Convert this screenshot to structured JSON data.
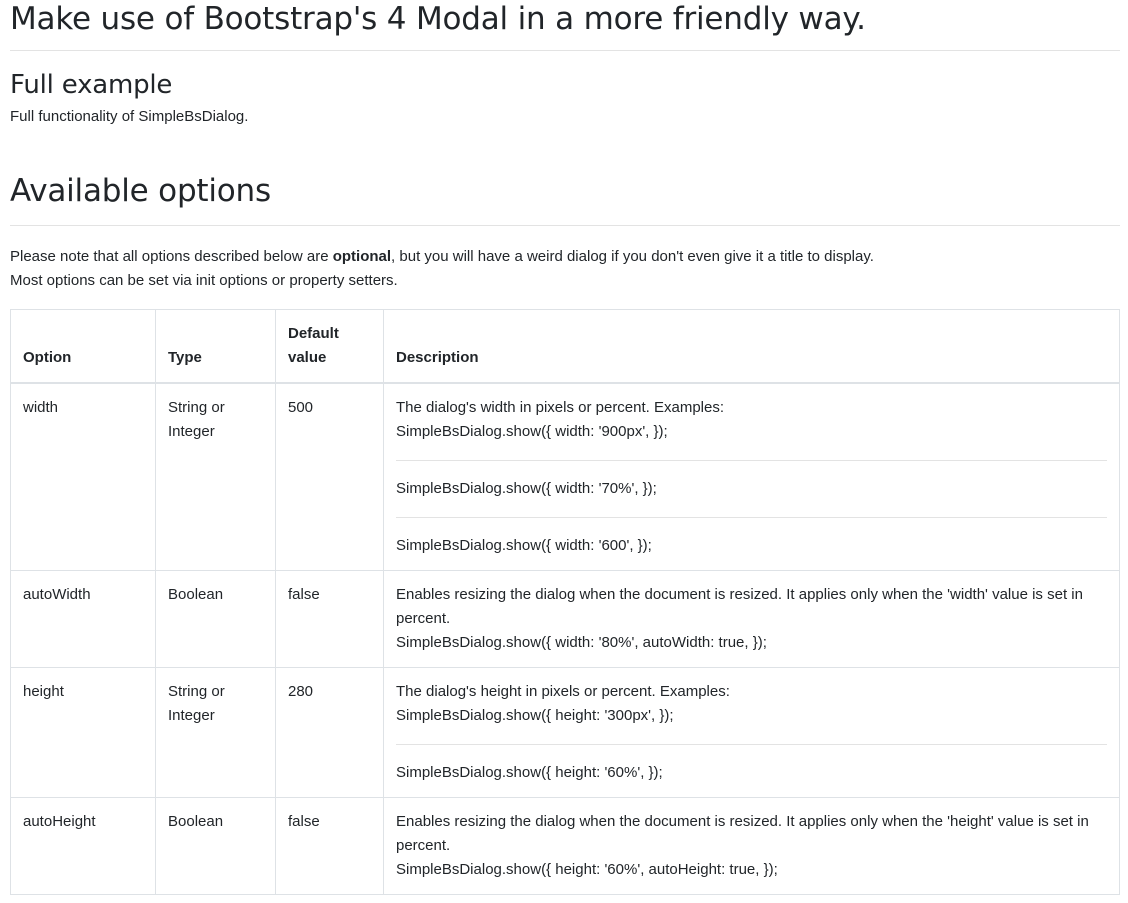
{
  "title": "Make use of Bootstrap's 4 Modal in a more friendly way.",
  "full_example": {
    "heading": "Full example",
    "text": "Full functionality of SimpleBsDialog."
  },
  "available_options": {
    "heading": "Available options",
    "note_pre": "Please note that all options described below are ",
    "note_bold": "optional",
    "note_post": ", but you will have a weird dialog if you don't even give it a title to display.",
    "note_line2": "Most options can be set via init options or property setters."
  },
  "table": {
    "headers": {
      "option": "Option",
      "type": "Type",
      "default": "Default value",
      "description": "Description"
    },
    "rows": [
      {
        "option": "width",
        "type": "String or Integer",
        "default": "500",
        "description": "The dialog's width in pixels or percent. Examples:",
        "examples": [
          "SimpleBsDialog.show({ width: '900px', });",
          "SimpleBsDialog.show({ width: '70%', });",
          "SimpleBsDialog.show({ width: '600', });"
        ]
      },
      {
        "option": "autoWidth",
        "type": "Boolean",
        "default": "false",
        "description": "Enables resizing the dialog when the document is resized. It applies only when the 'width' value is set in percent.",
        "examples": [
          "SimpleBsDialog.show({ width: '80%', autoWidth: true, });"
        ]
      },
      {
        "option": "height",
        "type": "String or Integer",
        "default": "280",
        "description": "The dialog's height in pixels or percent. Examples:",
        "examples": [
          "SimpleBsDialog.show({ height: '300px', });",
          "SimpleBsDialog.show({ height: '60%', });"
        ]
      },
      {
        "option": "autoHeight",
        "type": "Boolean",
        "default": "false",
        "description": "Enables resizing the dialog when the document is resized. It applies only when the 'height' value is set in percent.",
        "examples": [
          "SimpleBsDialog.show({ height: '60%', autoHeight: true, });"
        ]
      }
    ]
  }
}
